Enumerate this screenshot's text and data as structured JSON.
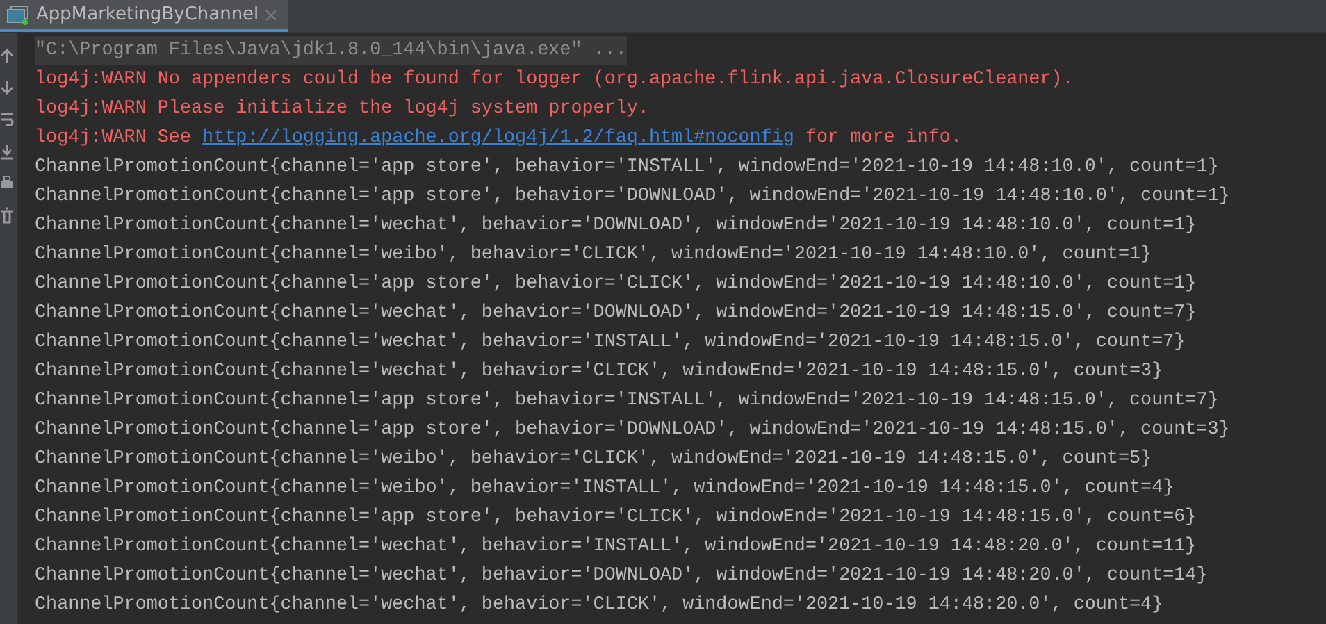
{
  "tab": {
    "title": "AppMarketingByChannel",
    "selected": true
  },
  "console": {
    "command": "\"C:\\Program Files\\Java\\jdk1.8.0_144\\bin\\java.exe\" ...",
    "lines": [
      {
        "kind": "warn",
        "text": "log4j:WARN No appenders could be found for logger (org.apache.flink.api.java.ClosureCleaner)."
      },
      {
        "kind": "warn",
        "text": "log4j:WARN Please initialize the log4j system properly."
      },
      {
        "kind": "warn_link",
        "before": "log4j:WARN See ",
        "link": "http://logging.apache.org/log4j/1.2/faq.html#noconfig",
        "after": " for more info."
      },
      {
        "kind": "out",
        "text": "ChannelPromotionCount{channel='app store', behavior='INSTALL', windowEnd='2021-10-19 14:48:10.0', count=1}"
      },
      {
        "kind": "out",
        "text": "ChannelPromotionCount{channel='app store', behavior='DOWNLOAD', windowEnd='2021-10-19 14:48:10.0', count=1}"
      },
      {
        "kind": "out",
        "text": "ChannelPromotionCount{channel='wechat', behavior='DOWNLOAD', windowEnd='2021-10-19 14:48:10.0', count=1}"
      },
      {
        "kind": "out",
        "text": "ChannelPromotionCount{channel='weibo', behavior='CLICK', windowEnd='2021-10-19 14:48:10.0', count=1}"
      },
      {
        "kind": "out",
        "text": "ChannelPromotionCount{channel='app store', behavior='CLICK', windowEnd='2021-10-19 14:48:10.0', count=1}"
      },
      {
        "kind": "out",
        "text": "ChannelPromotionCount{channel='wechat', behavior='DOWNLOAD', windowEnd='2021-10-19 14:48:15.0', count=7}"
      },
      {
        "kind": "out",
        "text": "ChannelPromotionCount{channel='wechat', behavior='INSTALL', windowEnd='2021-10-19 14:48:15.0', count=7}"
      },
      {
        "kind": "out",
        "text": "ChannelPromotionCount{channel='wechat', behavior='CLICK', windowEnd='2021-10-19 14:48:15.0', count=3}"
      },
      {
        "kind": "out",
        "text": "ChannelPromotionCount{channel='app store', behavior='INSTALL', windowEnd='2021-10-19 14:48:15.0', count=7}"
      },
      {
        "kind": "out",
        "text": "ChannelPromotionCount{channel='app store', behavior='DOWNLOAD', windowEnd='2021-10-19 14:48:15.0', count=3}"
      },
      {
        "kind": "out",
        "text": "ChannelPromotionCount{channel='weibo', behavior='CLICK', windowEnd='2021-10-19 14:48:15.0', count=5}"
      },
      {
        "kind": "out",
        "text": "ChannelPromotionCount{channel='weibo', behavior='INSTALL', windowEnd='2021-10-19 14:48:15.0', count=4}"
      },
      {
        "kind": "out",
        "text": "ChannelPromotionCount{channel='app store', behavior='CLICK', windowEnd='2021-10-19 14:48:15.0', count=6}"
      },
      {
        "kind": "out",
        "text": "ChannelPromotionCount{channel='wechat', behavior='INSTALL', windowEnd='2021-10-19 14:48:20.0', count=11}"
      },
      {
        "kind": "out",
        "text": "ChannelPromotionCount{channel='wechat', behavior='DOWNLOAD', windowEnd='2021-10-19 14:48:20.0', count=14}"
      },
      {
        "kind": "out",
        "text": "ChannelPromotionCount{channel='wechat', behavior='CLICK', windowEnd='2021-10-19 14:48:20.0', count=4}"
      }
    ]
  }
}
